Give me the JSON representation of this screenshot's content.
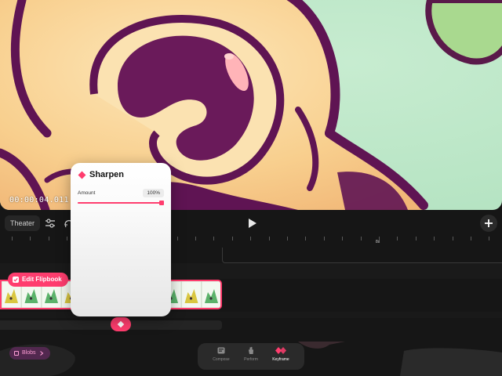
{
  "preview": {
    "timecode": "00:00:04.011",
    "colors": {
      "bg": "#bfe9c8",
      "face": "#f7c98a",
      "outline": "#6a1a5a",
      "shine": "#ffb4b8"
    }
  },
  "toolbar": {
    "theater_label": "Theater",
    "icons": [
      "sliders-icon",
      "loop-icon",
      "play-icon",
      "plus-icon"
    ]
  },
  "ruler": {
    "marker_label": "8s"
  },
  "timeline": {
    "edit_flipbook_label": "Edit Flipbook",
    "accent": "#ff3d6e"
  },
  "popup": {
    "title": "Sharpen",
    "param_label": "Amount",
    "param_value": "100%",
    "param_fraction": 1.0
  },
  "bottom": {
    "blobs_label": "Blobs",
    "modes": [
      {
        "label": "Compose",
        "icon": "compose-icon",
        "active": false
      },
      {
        "label": "Perform",
        "icon": "hand-icon",
        "active": false
      },
      {
        "label": "Keyframe",
        "icon": "keyframe-icon",
        "active": true
      }
    ]
  }
}
